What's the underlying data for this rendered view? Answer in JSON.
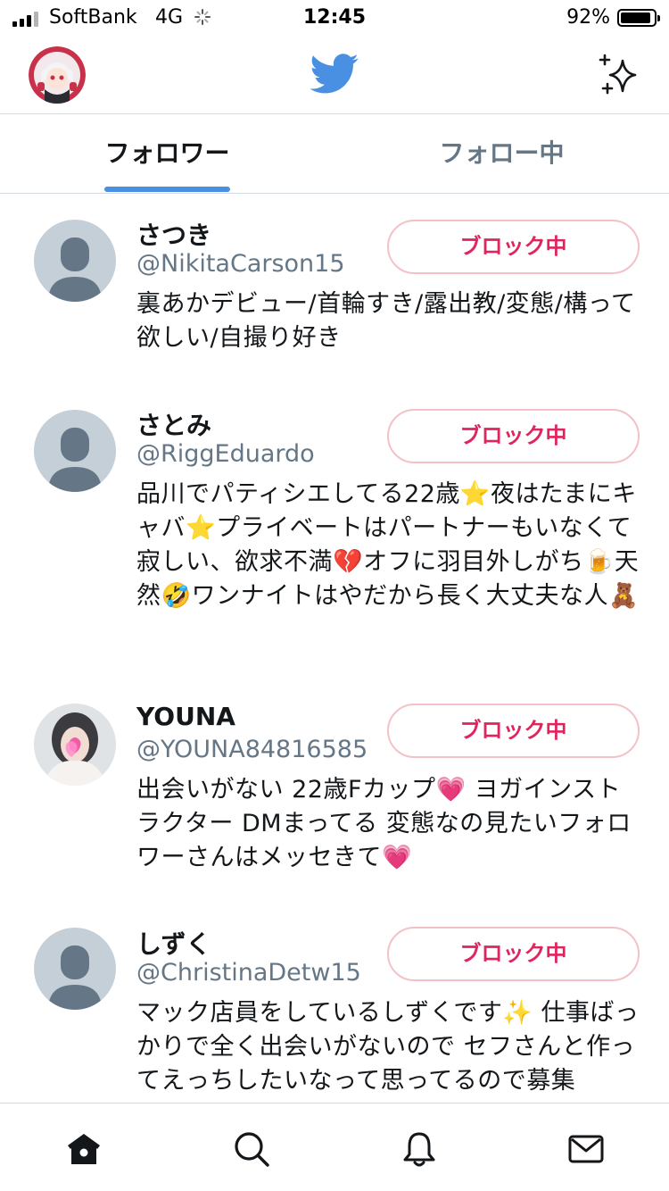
{
  "status_bar": {
    "carrier": "SoftBank",
    "network": "4G",
    "time": "12:45",
    "battery_percent_text": "92%",
    "battery_level": 0.92,
    "signal_bars": 4
  },
  "header": {
    "logo": "twitter-bird-icon",
    "brand_color": "#4a90e2",
    "right_action_icon": "sparkle-icon"
  },
  "tabs": [
    {
      "label": "フォロワー",
      "selected": true
    },
    {
      "label": "フォロー中",
      "selected": false
    }
  ],
  "users": [
    {
      "name": "さつき",
      "handle": "@NikitaCarson15",
      "button": "ブロック中",
      "bio": "裏あかデビュー/首輪すき/露出教/変態/構って欲しい/自撮り好き",
      "avatar": "default"
    },
    {
      "name": "さとみ",
      "handle": "@RiggEduardo",
      "button": "ブロック中",
      "bio": "品川でパティシエしてる22歳⭐夜はたまにキャバ⭐プライベートはパートナーもいなくて寂しい、欲求不満💔オフに羽目外しがち🍺天然🤣ワンナイトはやだから長く大丈夫な人🧸",
      "avatar": "default"
    },
    {
      "name": "YOUNA",
      "handle": "@YOUNA84816585",
      "button": "ブロック中",
      "bio": "出会いがない 22歳Fカップ💗 ヨガインストラクター DMまってる 変態なの見たいフォロワーさんはメッセきて💗",
      "avatar": "photo"
    },
    {
      "name": "しずく",
      "handle": "@ChristinaDetw15",
      "button": "ブロック中",
      "bio": "マック店員をしているしずくです✨ 仕事ばっかりで全く出会いがないので セフさんと作ってえっちしたいなって思ってるので募集",
      "avatar": "default"
    }
  ],
  "bottom_nav": [
    {
      "icon": "home-icon",
      "active": true
    },
    {
      "icon": "search-icon",
      "active": false
    },
    {
      "icon": "bell-icon",
      "active": false
    },
    {
      "icon": "mail-icon",
      "active": false
    }
  ]
}
